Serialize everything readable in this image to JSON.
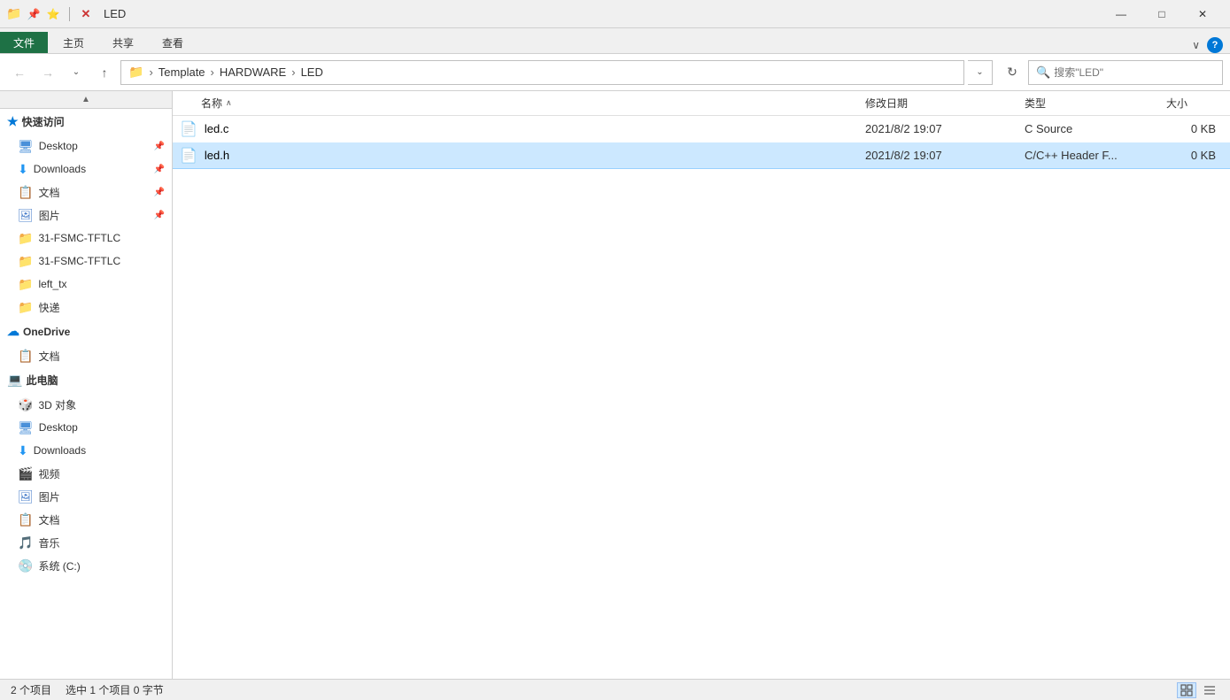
{
  "titleBar": {
    "title": "LED",
    "icons": {
      "folder": "📁",
      "pin": "📌",
      "star": "⭐",
      "closeX": "✕"
    },
    "windowControls": {
      "minimize": "—",
      "maximize": "□",
      "close": "✕"
    }
  },
  "ribbon": {
    "tabs": [
      {
        "id": "file",
        "label": "文件",
        "active": false
      },
      {
        "id": "home",
        "label": "主页",
        "active": false
      },
      {
        "id": "share",
        "label": "共享",
        "active": false
      },
      {
        "id": "view",
        "label": "查看",
        "active": false
      }
    ],
    "expandIcon": "∨",
    "helpIcon": "?"
  },
  "addressBar": {
    "backIcon": "←",
    "forwardIcon": "→",
    "upIcon": "↑",
    "dropdownIcon": "⌄",
    "pathFolderIcon": "📁",
    "pathSegments": [
      "Template",
      "HARDWARE",
      "LED"
    ],
    "refreshIcon": "↻",
    "searchPlaceholder": "搜索\"LED\"",
    "searchIconChar": "🔍"
  },
  "sidebar": {
    "scrollUpIcon": "▲",
    "sections": {
      "quickAccess": {
        "icon": "★",
        "label": "快速访问",
        "items": [
          {
            "id": "desktop",
            "label": "Desktop",
            "iconType": "desktop",
            "pinned": true
          },
          {
            "id": "downloads",
            "label": "Downloads",
            "iconType": "downloads",
            "pinned": true
          },
          {
            "id": "docs",
            "label": "文档",
            "iconType": "docs",
            "pinned": true
          },
          {
            "id": "pics",
            "label": "图片",
            "iconType": "pics",
            "pinned": true
          },
          {
            "id": "folder1",
            "label": "31-FSMC-TFTLC",
            "iconType": "folder-yellow",
            "pinned": false
          },
          {
            "id": "folder2",
            "label": "31-FSMC-TFTLC",
            "iconType": "folder-yellow",
            "pinned": false
          },
          {
            "id": "folder3",
            "label": "left_tx",
            "iconType": "folder-yellow",
            "pinned": false
          },
          {
            "id": "folder4",
            "label": "快递",
            "iconType": "folder-yellow",
            "pinned": false
          }
        ]
      },
      "oneDrive": {
        "icon": "☁",
        "label": "OneDrive",
        "items": [
          {
            "id": "onedrive-docs",
            "label": "文档",
            "iconType": "onedrive-docs",
            "pinned": false
          }
        ]
      },
      "thisPC": {
        "icon": "💻",
        "label": "此电脑",
        "items": [
          {
            "id": "3d-objects",
            "label": "3D 对象",
            "iconType": "three-d",
            "pinned": false
          },
          {
            "id": "pc-desktop",
            "label": "Desktop",
            "iconType": "desktop",
            "pinned": false
          },
          {
            "id": "pc-downloads",
            "label": "Downloads",
            "iconType": "downloads",
            "pinned": false
          },
          {
            "id": "videos",
            "label": "视频",
            "iconType": "video",
            "pinned": false
          },
          {
            "id": "pictures",
            "label": "图片",
            "iconType": "pics",
            "pinned": false
          },
          {
            "id": "documents",
            "label": "文档",
            "iconType": "docs",
            "pinned": false
          },
          {
            "id": "music",
            "label": "音乐",
            "iconType": "music",
            "pinned": false
          },
          {
            "id": "system-c",
            "label": "系统 (C:)",
            "iconType": "drive",
            "pinned": false
          }
        ]
      }
    }
  },
  "fileList": {
    "columns": {
      "name": "名称",
      "date": "修改日期",
      "type": "类型",
      "size": "大小",
      "sortArrow": "∧"
    },
    "files": [
      {
        "id": "led-c",
        "name": "led.c",
        "icon": "📄",
        "date": "2021/8/2 19:07",
        "type": "C Source",
        "size": "0 KB",
        "selected": false
      },
      {
        "id": "led-h",
        "name": "led.h",
        "icon": "📄",
        "date": "2021/8/2 19:07",
        "type": "C/C++ Header F...",
        "size": "0 KB",
        "selected": true
      }
    ]
  },
  "statusBar": {
    "itemCount": "2 个项目",
    "selectedInfo": "选中 1 个项目 0 字节",
    "gridViewIcon": "▦",
    "listViewIcon": "≡"
  }
}
